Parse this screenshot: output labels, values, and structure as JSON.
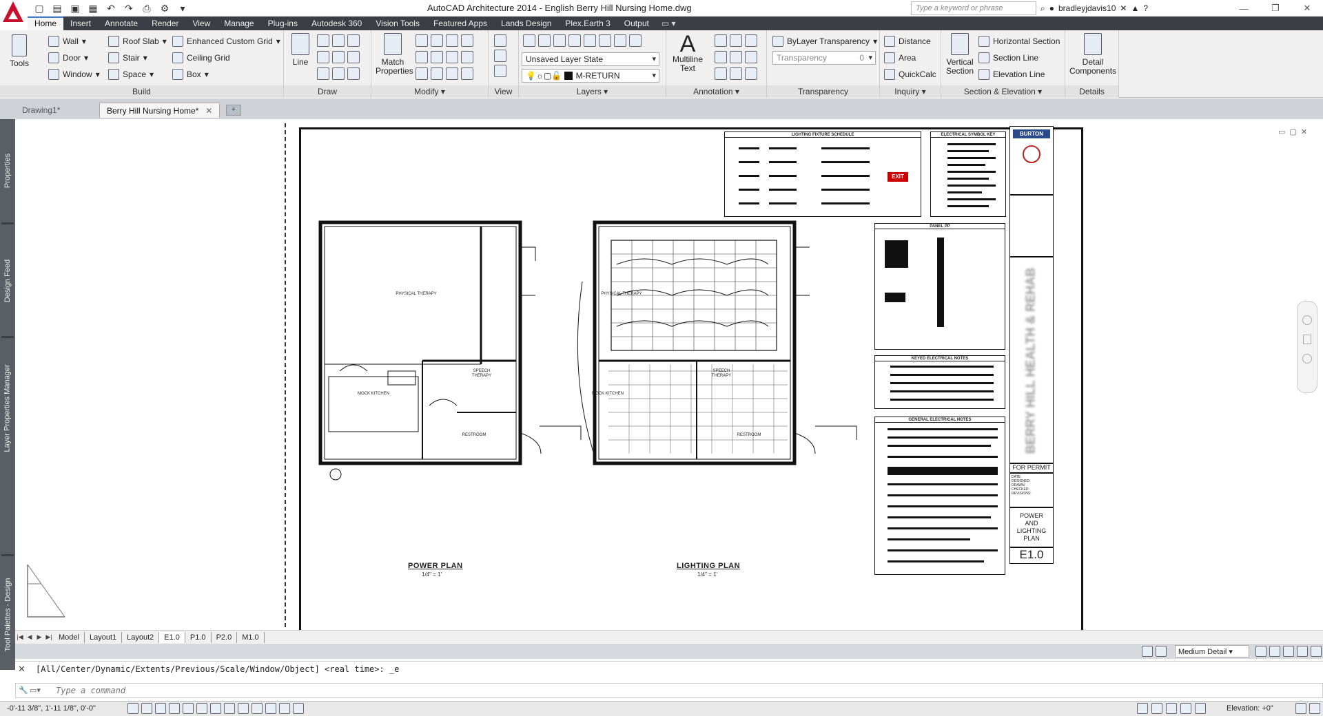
{
  "title": "AutoCAD Architecture 2014 - English    Berry Hill Nursing Home.dwg",
  "search": {
    "placeholder": "Type a keyword or phrase"
  },
  "user": {
    "name": "bradleyjdavis10"
  },
  "ribbon_tabs": [
    "Home",
    "Insert",
    "Annotate",
    "Render",
    "View",
    "Manage",
    "Plug-ins",
    "Autodesk 360",
    "Vision Tools",
    "Featured Apps",
    "Lands Design",
    "Plex.Earth 3",
    "Output"
  ],
  "ribbon": {
    "build": {
      "title": "Build",
      "tools_label": "Tools",
      "wall": "Wall",
      "door": "Door",
      "window": "Window",
      "roof_slab": "Roof Slab",
      "stair": "Stair",
      "space": "Space",
      "enhanced_grid": "Enhanced Custom Grid",
      "ceiling_grid": "Ceiling Grid",
      "box": "Box"
    },
    "draw": {
      "title": "Draw",
      "line": "Line"
    },
    "modify": {
      "title": "Modify",
      "match_properties": "Match Properties"
    },
    "view": {
      "title": "View"
    },
    "layers": {
      "title": "Layers",
      "layer_state": "Unsaved Layer State",
      "current_layer": "M-RETURN"
    },
    "annotation": {
      "title": "Annotation",
      "multiline_text": "Multiline Text"
    },
    "transparency": {
      "title": "Transparency",
      "bylayer": "ByLayer Transparency",
      "label": "Transparency",
      "value": "0"
    },
    "inquiry": {
      "title": "Inquiry",
      "distance": "Distance",
      "area": "Area",
      "quickcalc": "QuickCalc"
    },
    "section": {
      "title": "Section & Elevation",
      "vertical_section": "Vertical Section",
      "horizontal_section": "Horizontal Section",
      "section_line": "Section Line",
      "elevation_line": "Elevation Line"
    },
    "details": {
      "title": "Details",
      "detail_components": "Detail Components"
    }
  },
  "doc_tabs": [
    "Drawing1*",
    "Berry Hill Nursing Home*"
  ],
  "palettes": [
    "Properties",
    "Design Feed",
    "Layer Properties Manager",
    "Tool Palettes - Design"
  ],
  "drawing": {
    "power_plan_title": "POWER PLAN",
    "power_plan_scale": "1/4\" = 1'",
    "lighting_plan_title": "LIGHTING PLAN",
    "lighting_plan_scale": "1/4\" = 1'",
    "rooms": {
      "physical_therapy": "PHYSICAL THERAPY",
      "mock_kitchen": "MOCK KITCHEN",
      "restroom": "RESTROOM",
      "speech_therapy": "SPEECH THERAPY"
    },
    "lighting_schedule_title": "LIGHTING FIXTURE SCHEDULE",
    "symbol_key_title": "ELECTRICAL SYMBOL KEY",
    "panel_title": "PANEL PP",
    "keyed_notes_title": "KEYED ELECTRICAL NOTES",
    "general_notes_title": "GENERAL ELECTRICAL NOTES",
    "exit_sign": "EXIT"
  },
  "titleblock": {
    "company": "BURTON",
    "project": "BERRY HILL HEALTH & REHAB",
    "status": "FOR PERMIT",
    "info_lines": [
      "DATE:",
      "DESIGNED:",
      "DRAWN:",
      "CHECKED:",
      "REVISIONS:"
    ],
    "sheet_title": "POWER AND LIGHTING PLAN",
    "sheet_number": "E1.0"
  },
  "layout_tabs": [
    "Model",
    "Layout1",
    "Layout2",
    "E1.0",
    "P1.0",
    "P2.0",
    "M1.0"
  ],
  "status": {
    "detail_level": "Medium Detail"
  },
  "command": {
    "history": "[All/Center/Dynamic/Extents/Previous/Scale/Window/Object] <real time>: _e",
    "placeholder": "Type a command"
  },
  "statusbar": {
    "coords": "-0'-11 3/8\", 1'-11 1/8\", 0'-0\"",
    "elevation": "Elevation: +0\""
  }
}
